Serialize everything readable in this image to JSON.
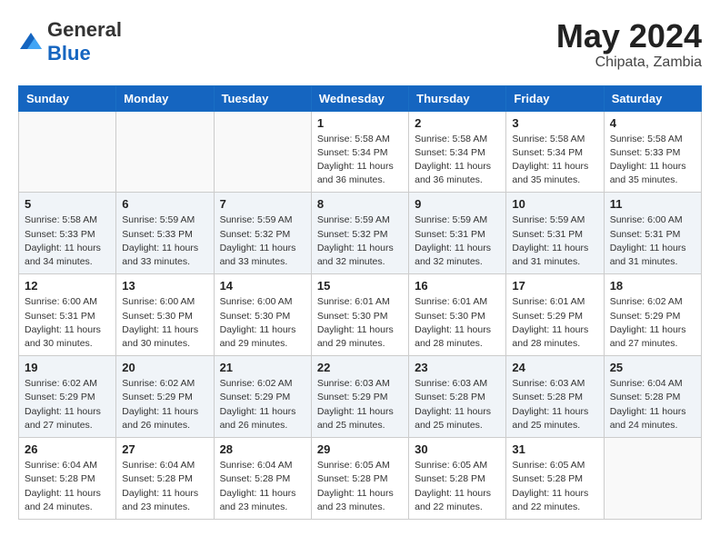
{
  "header": {
    "logo_general": "General",
    "logo_blue": "Blue",
    "title": "May 2024",
    "location": "Chipata, Zambia"
  },
  "days_of_week": [
    "Sunday",
    "Monday",
    "Tuesday",
    "Wednesday",
    "Thursday",
    "Friday",
    "Saturday"
  ],
  "weeks": [
    {
      "shaded": false,
      "days": [
        {
          "num": "",
          "info": ""
        },
        {
          "num": "",
          "info": ""
        },
        {
          "num": "",
          "info": ""
        },
        {
          "num": "1",
          "info": "Sunrise: 5:58 AM\nSunset: 5:34 PM\nDaylight: 11 hours\nand 36 minutes."
        },
        {
          "num": "2",
          "info": "Sunrise: 5:58 AM\nSunset: 5:34 PM\nDaylight: 11 hours\nand 36 minutes."
        },
        {
          "num": "3",
          "info": "Sunrise: 5:58 AM\nSunset: 5:34 PM\nDaylight: 11 hours\nand 35 minutes."
        },
        {
          "num": "4",
          "info": "Sunrise: 5:58 AM\nSunset: 5:33 PM\nDaylight: 11 hours\nand 35 minutes."
        }
      ]
    },
    {
      "shaded": true,
      "days": [
        {
          "num": "5",
          "info": "Sunrise: 5:58 AM\nSunset: 5:33 PM\nDaylight: 11 hours\nand 34 minutes."
        },
        {
          "num": "6",
          "info": "Sunrise: 5:59 AM\nSunset: 5:33 PM\nDaylight: 11 hours\nand 33 minutes."
        },
        {
          "num": "7",
          "info": "Sunrise: 5:59 AM\nSunset: 5:32 PM\nDaylight: 11 hours\nand 33 minutes."
        },
        {
          "num": "8",
          "info": "Sunrise: 5:59 AM\nSunset: 5:32 PM\nDaylight: 11 hours\nand 32 minutes."
        },
        {
          "num": "9",
          "info": "Sunrise: 5:59 AM\nSunset: 5:31 PM\nDaylight: 11 hours\nand 32 minutes."
        },
        {
          "num": "10",
          "info": "Sunrise: 5:59 AM\nSunset: 5:31 PM\nDaylight: 11 hours\nand 31 minutes."
        },
        {
          "num": "11",
          "info": "Sunrise: 6:00 AM\nSunset: 5:31 PM\nDaylight: 11 hours\nand 31 minutes."
        }
      ]
    },
    {
      "shaded": false,
      "days": [
        {
          "num": "12",
          "info": "Sunrise: 6:00 AM\nSunset: 5:31 PM\nDaylight: 11 hours\nand 30 minutes."
        },
        {
          "num": "13",
          "info": "Sunrise: 6:00 AM\nSunset: 5:30 PM\nDaylight: 11 hours\nand 30 minutes."
        },
        {
          "num": "14",
          "info": "Sunrise: 6:00 AM\nSunset: 5:30 PM\nDaylight: 11 hours\nand 29 minutes."
        },
        {
          "num": "15",
          "info": "Sunrise: 6:01 AM\nSunset: 5:30 PM\nDaylight: 11 hours\nand 29 minutes."
        },
        {
          "num": "16",
          "info": "Sunrise: 6:01 AM\nSunset: 5:30 PM\nDaylight: 11 hours\nand 28 minutes."
        },
        {
          "num": "17",
          "info": "Sunrise: 6:01 AM\nSunset: 5:29 PM\nDaylight: 11 hours\nand 28 minutes."
        },
        {
          "num": "18",
          "info": "Sunrise: 6:02 AM\nSunset: 5:29 PM\nDaylight: 11 hours\nand 27 minutes."
        }
      ]
    },
    {
      "shaded": true,
      "days": [
        {
          "num": "19",
          "info": "Sunrise: 6:02 AM\nSunset: 5:29 PM\nDaylight: 11 hours\nand 27 minutes."
        },
        {
          "num": "20",
          "info": "Sunrise: 6:02 AM\nSunset: 5:29 PM\nDaylight: 11 hours\nand 26 minutes."
        },
        {
          "num": "21",
          "info": "Sunrise: 6:02 AM\nSunset: 5:29 PM\nDaylight: 11 hours\nand 26 minutes."
        },
        {
          "num": "22",
          "info": "Sunrise: 6:03 AM\nSunset: 5:29 PM\nDaylight: 11 hours\nand 25 minutes."
        },
        {
          "num": "23",
          "info": "Sunrise: 6:03 AM\nSunset: 5:28 PM\nDaylight: 11 hours\nand 25 minutes."
        },
        {
          "num": "24",
          "info": "Sunrise: 6:03 AM\nSunset: 5:28 PM\nDaylight: 11 hours\nand 25 minutes."
        },
        {
          "num": "25",
          "info": "Sunrise: 6:04 AM\nSunset: 5:28 PM\nDaylight: 11 hours\nand 24 minutes."
        }
      ]
    },
    {
      "shaded": false,
      "days": [
        {
          "num": "26",
          "info": "Sunrise: 6:04 AM\nSunset: 5:28 PM\nDaylight: 11 hours\nand 24 minutes."
        },
        {
          "num": "27",
          "info": "Sunrise: 6:04 AM\nSunset: 5:28 PM\nDaylight: 11 hours\nand 23 minutes."
        },
        {
          "num": "28",
          "info": "Sunrise: 6:04 AM\nSunset: 5:28 PM\nDaylight: 11 hours\nand 23 minutes."
        },
        {
          "num": "29",
          "info": "Sunrise: 6:05 AM\nSunset: 5:28 PM\nDaylight: 11 hours\nand 23 minutes."
        },
        {
          "num": "30",
          "info": "Sunrise: 6:05 AM\nSunset: 5:28 PM\nDaylight: 11 hours\nand 22 minutes."
        },
        {
          "num": "31",
          "info": "Sunrise: 6:05 AM\nSunset: 5:28 PM\nDaylight: 11 hours\nand 22 minutes."
        },
        {
          "num": "",
          "info": ""
        }
      ]
    }
  ]
}
